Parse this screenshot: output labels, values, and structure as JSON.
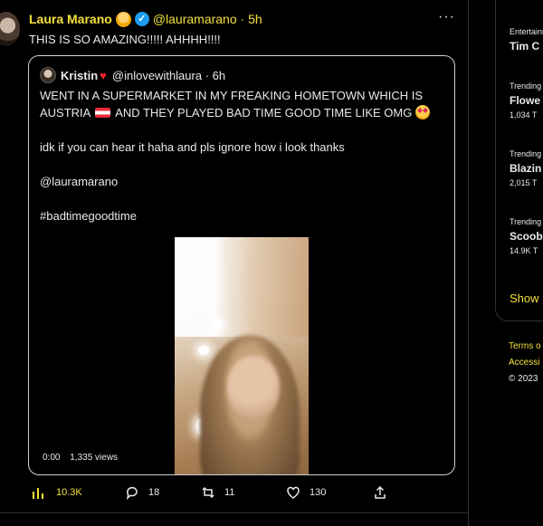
{
  "tweet": {
    "name": "Laura Marano",
    "handle": "@lauramarano · 5h",
    "text": "THIS IS SO AMAZING!!!!! AHHHH!!!!",
    "more_icon": "more-icon"
  },
  "quote": {
    "name": "Kristin",
    "handle": "@inlovewithlaura · 6h",
    "line1_a": "WENT IN A SUPERMARKET IN MY FREAKING HOMETOWN WHICH IS",
    "line1_b": "AUSTRIA",
    "line1_c": "AND THEY PLAYED BAD TIME GOOD TIME LIKE OMG",
    "line2": "idk if you can hear it haha and pls ignore how i look thanks",
    "mention": "@lauramarano",
    "hashtag": "#badtimegoodtime",
    "video_time": "0:00",
    "video_views": "1,335 views"
  },
  "actions": {
    "views": "10.3K",
    "replies": "18",
    "retweets": "11",
    "likes": "130"
  },
  "trends": [
    {
      "category": "Entertainment",
      "name": "Tim C",
      "count": ""
    },
    {
      "category": "Trending",
      "name": "Flowe",
      "count": "1,034 T"
    },
    {
      "category": "Trending",
      "name": "Blazin",
      "count": "2,015 T"
    },
    {
      "category": "Trending",
      "name": "Scoob",
      "count": "14.9K T"
    }
  ],
  "show_more": "Show",
  "footer": {
    "terms": "Terms o",
    "accessibility": "Accessi",
    "copyright": "© 2023"
  },
  "colors": {
    "accent": "#f5e13a",
    "background": "#000000",
    "text": "#e7e9ea"
  }
}
